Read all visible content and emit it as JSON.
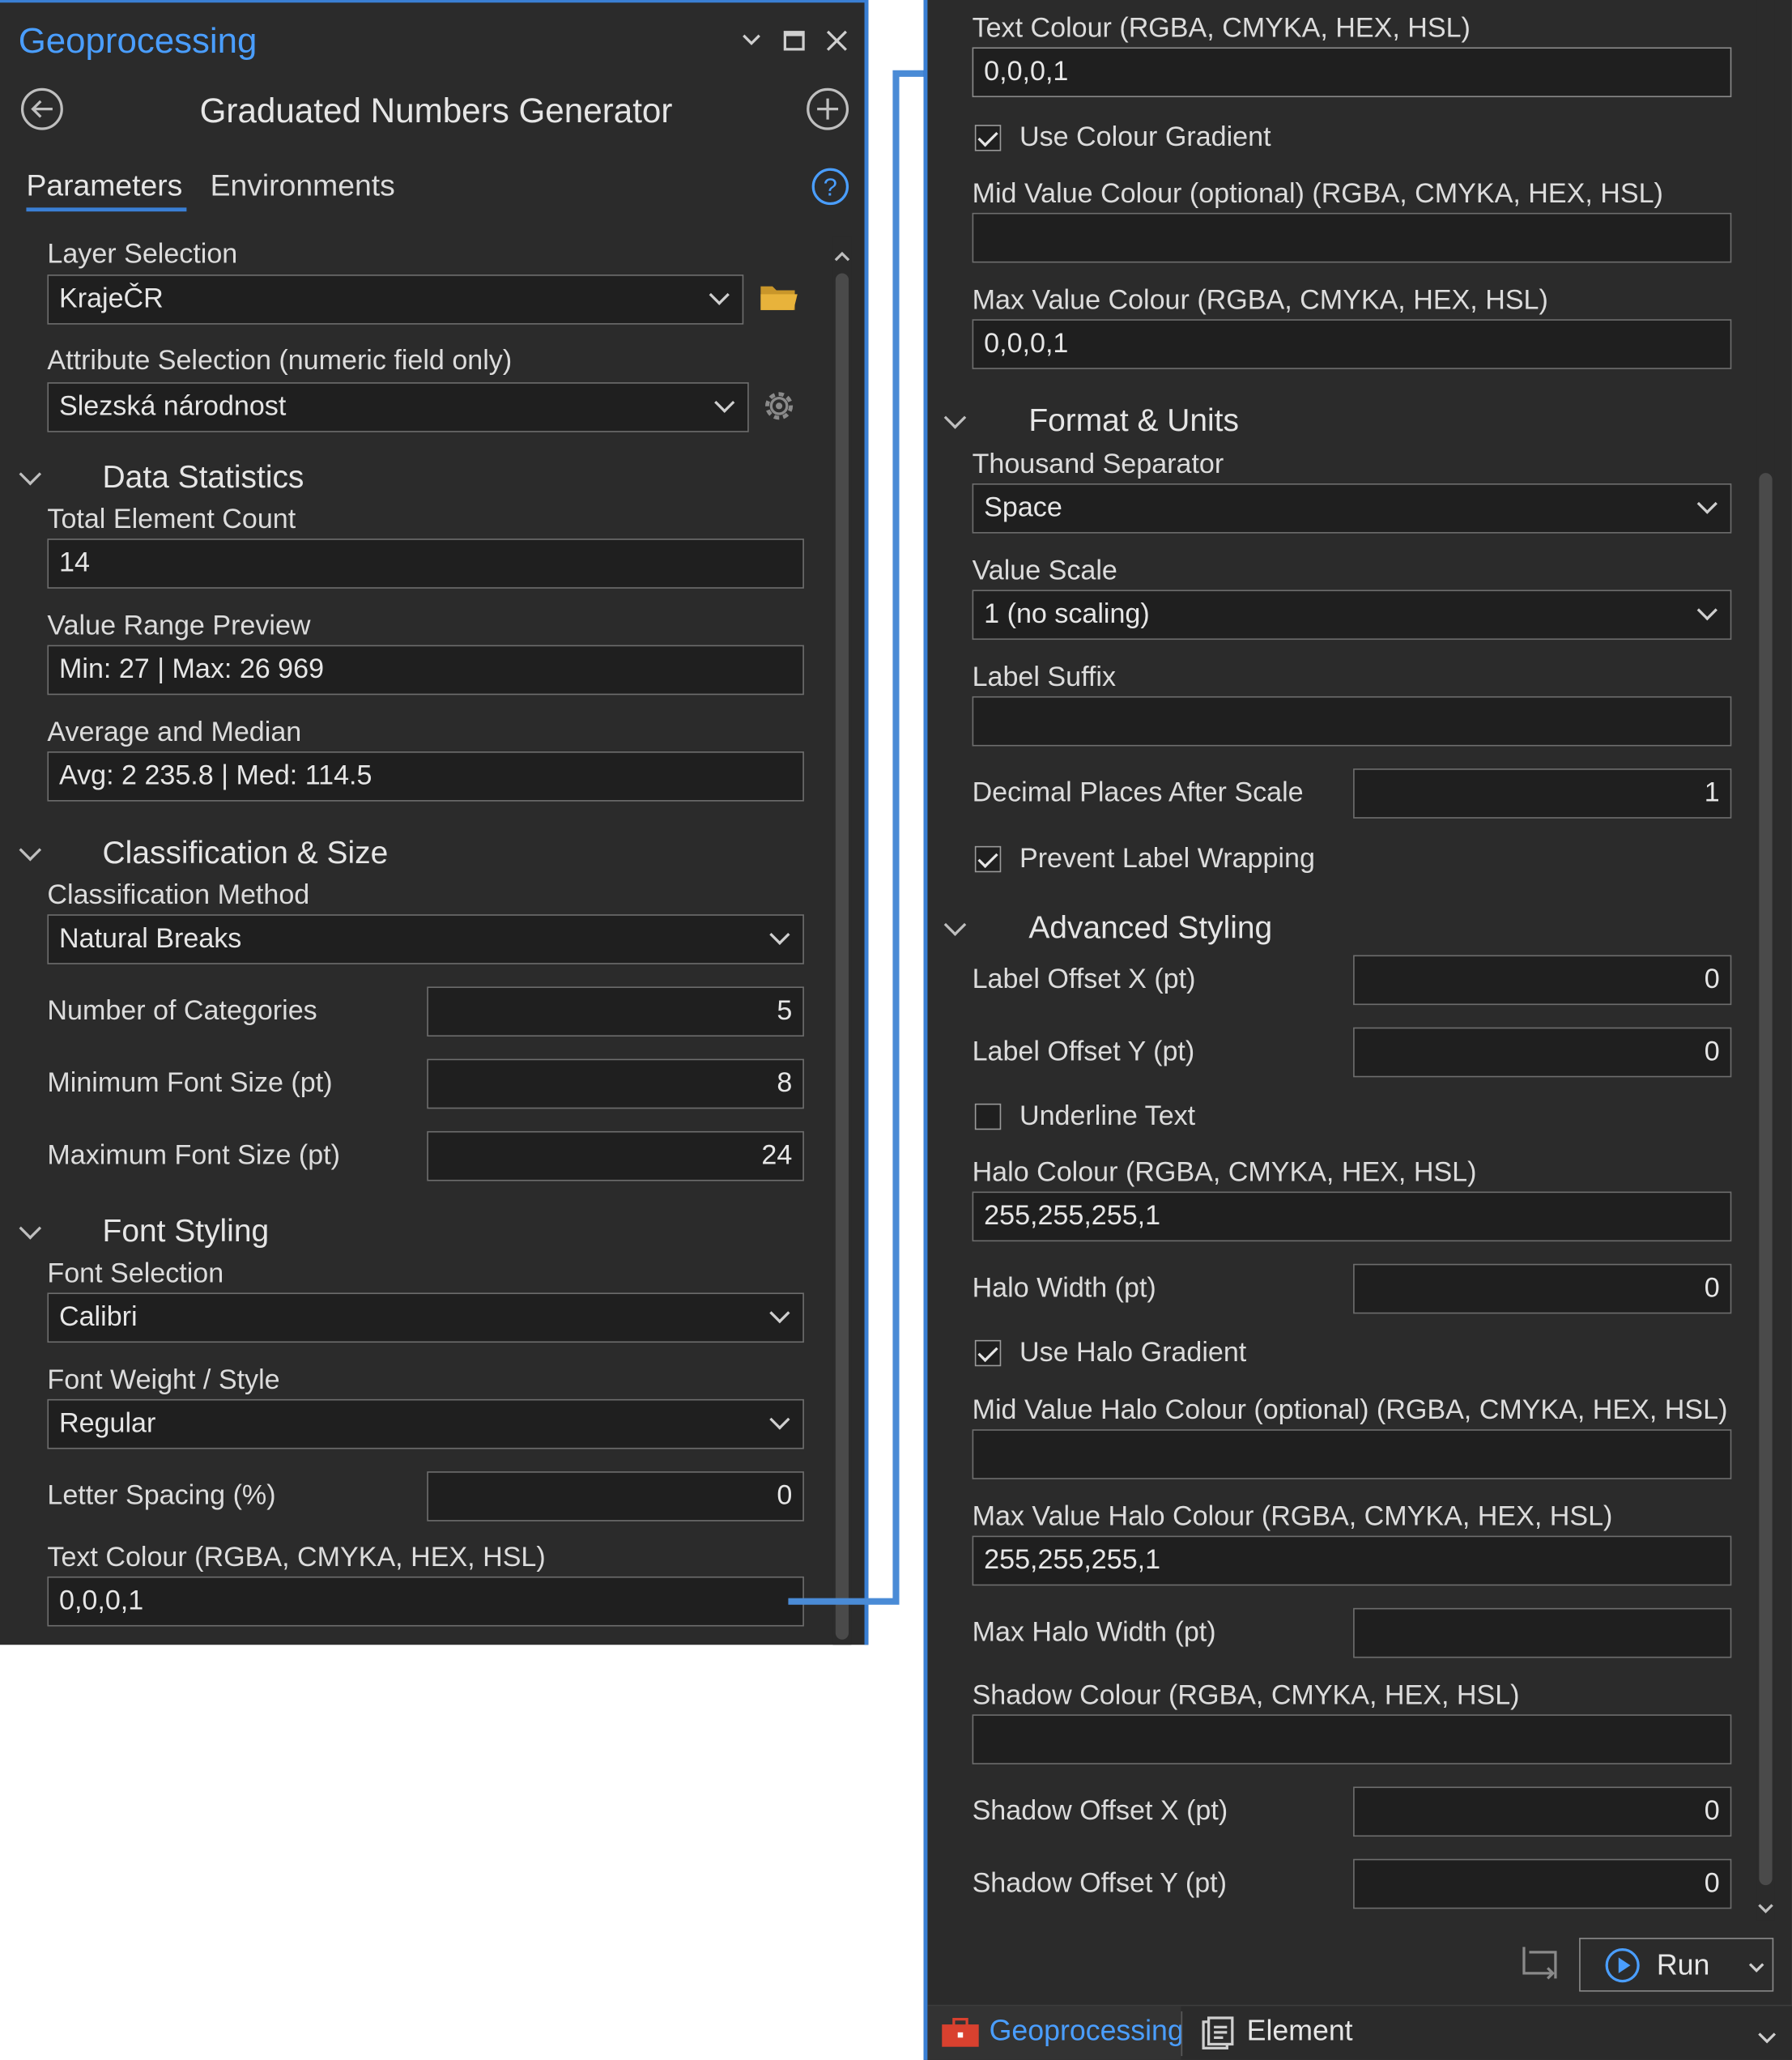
{
  "header": {
    "pane_title": "Geoprocessing",
    "tool_title": "Graduated Numbers Generator"
  },
  "tabs": {
    "parameters": "Parameters",
    "environments": "Environments"
  },
  "left": {
    "layer_selection_label": "Layer Selection",
    "layer_selection_value": "KrajeČR",
    "attribute_selection_label": "Attribute Selection (numeric field only)",
    "attribute_selection_value": "Slezská národnost",
    "data_statistics_group": "Data Statistics",
    "total_element_count_label": "Total Element Count",
    "total_element_count_value": "14",
    "value_range_label": "Value Range Preview",
    "value_range_value": "Min: 27 | Max: 26 969",
    "avg_median_label": "Average and Median",
    "avg_median_value": "Avg: 2 235.8 | Med: 114.5",
    "classification_group": "Classification & Size",
    "classification_method_label": "Classification Method",
    "classification_method_value": "Natural Breaks",
    "num_categories_label": "Number of Categories",
    "num_categories_value": "5",
    "min_font_label": "Minimum Font Size (pt)",
    "min_font_value": "8",
    "max_font_label": "Maximum Font Size (pt)",
    "max_font_value": "24",
    "font_styling_group": "Font Styling",
    "font_selection_label": "Font Selection",
    "font_selection_value": "Calibri",
    "font_weight_label": "Font Weight / Style",
    "font_weight_value": "Regular",
    "letter_spacing_label": "Letter Spacing (%)",
    "letter_spacing_value": "0",
    "text_colour_label": "Text Colour (RGBA, CMYKA, HEX, HSL)",
    "text_colour_value": "0,0,0,1"
  },
  "right": {
    "text_colour_label": "Text Colour (RGBA, CMYKA, HEX, HSL)",
    "text_colour_value": "0,0,0,1",
    "use_colour_gradient_label": "Use Colour Gradient",
    "use_colour_gradient_checked": true,
    "mid_value_colour_label": "Mid Value Colour (optional) (RGBA, CMYKA, HEX, HSL)",
    "mid_value_colour_value": "",
    "max_value_colour_label": "Max Value Colour (RGBA, CMYKA, HEX, HSL)",
    "max_value_colour_value": "0,0,0,1",
    "format_units_group": "Format & Units",
    "thousand_separator_label": "Thousand Separator",
    "thousand_separator_value": "Space",
    "value_scale_label": "Value Scale",
    "value_scale_value": "1 (no scaling)",
    "label_suffix_label": "Label Suffix",
    "label_suffix_value": "",
    "decimal_places_label": "Decimal Places After Scale",
    "decimal_places_value": "1",
    "prevent_wrapping_label": "Prevent Label Wrapping",
    "prevent_wrapping_checked": true,
    "advanced_styling_group": "Advanced Styling",
    "label_offset_x_label": "Label Offset X (pt)",
    "label_offset_x_value": "0",
    "label_offset_y_label": "Label Offset Y (pt)",
    "label_offset_y_value": "0",
    "underline_text_label": "Underline Text",
    "underline_text_checked": false,
    "halo_colour_label": "Halo Colour (RGBA, CMYKA, HEX, HSL)",
    "halo_colour_value": "255,255,255,1",
    "halo_width_label": "Halo Width (pt)",
    "halo_width_value": "0",
    "use_halo_gradient_label": "Use Halo Gradient",
    "use_halo_gradient_checked": true,
    "mid_halo_colour_label": "Mid Value Halo Colour  (optional)  (RGBA, CMYKA, HEX, HSL)",
    "mid_halo_colour_value": "",
    "max_halo_colour_label": "Max Value Halo Colour (RGBA, CMYKA, HEX, HSL)",
    "max_halo_colour_value": "255,255,255,1",
    "max_halo_width_label": "Max Halo Width (pt)",
    "max_halo_width_value": "",
    "shadow_colour_label": "Shadow Colour (RGBA, CMYKA, HEX, HSL)",
    "shadow_colour_value": "",
    "shadow_offset_x_label": "Shadow Offset X (pt)",
    "shadow_offset_x_value": "0",
    "shadow_offset_y_label": "Shadow Offset Y (pt)",
    "shadow_offset_y_value": "0",
    "run_label": "Run"
  },
  "bottom_tabs": {
    "geoprocessing": "Geoprocessing",
    "element": "Element"
  },
  "icons": [
    "back-arrow-icon",
    "add-icon",
    "help-icon",
    "folder-icon",
    "gear-icon",
    "dropdown-chevron-icon",
    "close-icon",
    "maximize-icon",
    "run-play-icon",
    "toolbox-icon",
    "element-icon",
    "swap-icon"
  ],
  "colors": {
    "accent": "#3a7fd4",
    "panel_bg": "#2b2b2b",
    "field_bg": "#1f1f1f",
    "folder": "#e8b33b"
  }
}
